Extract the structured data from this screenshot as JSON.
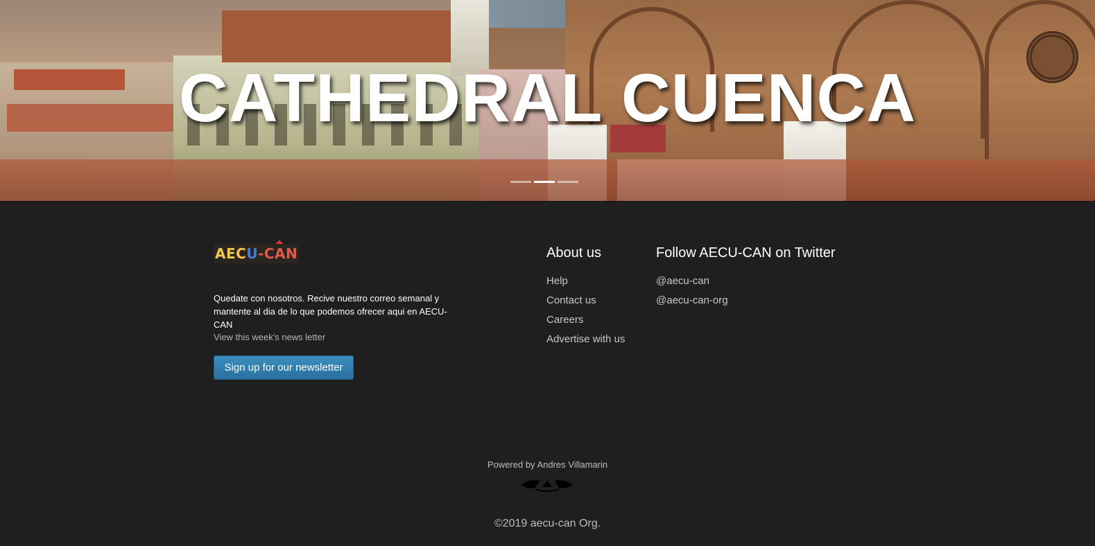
{
  "hero": {
    "title": "CATHEDRAL CUENCA",
    "slides": 3,
    "active_slide": 2
  },
  "footer": {
    "logo": {
      "part1": "AEC",
      "part2": "U",
      "part3": "-CAN"
    },
    "newsletter": {
      "text": "Quedate con nosotros. Recive nuestro correo semanal y mantente al dia de lo que podemos ofrecer aqui en AECU-CAN",
      "link": "View this week's news letter",
      "button": "Sign up for our newsletter"
    },
    "about": {
      "heading": "About us",
      "links": [
        "Help",
        "Contact us",
        "Careers",
        "Advertise with us"
      ]
    },
    "twitter": {
      "heading": "Follow AECU-CAN on Twitter",
      "links": [
        "@aecu-can",
        "@aecu-can-org"
      ]
    },
    "powered_by": "Powered by Andres Villamarin",
    "copyright": "©2019 aecu-can Org."
  },
  "colors": {
    "background": "#1f1f1f",
    "button": "#2f7fb0",
    "text": "#ffffff"
  }
}
